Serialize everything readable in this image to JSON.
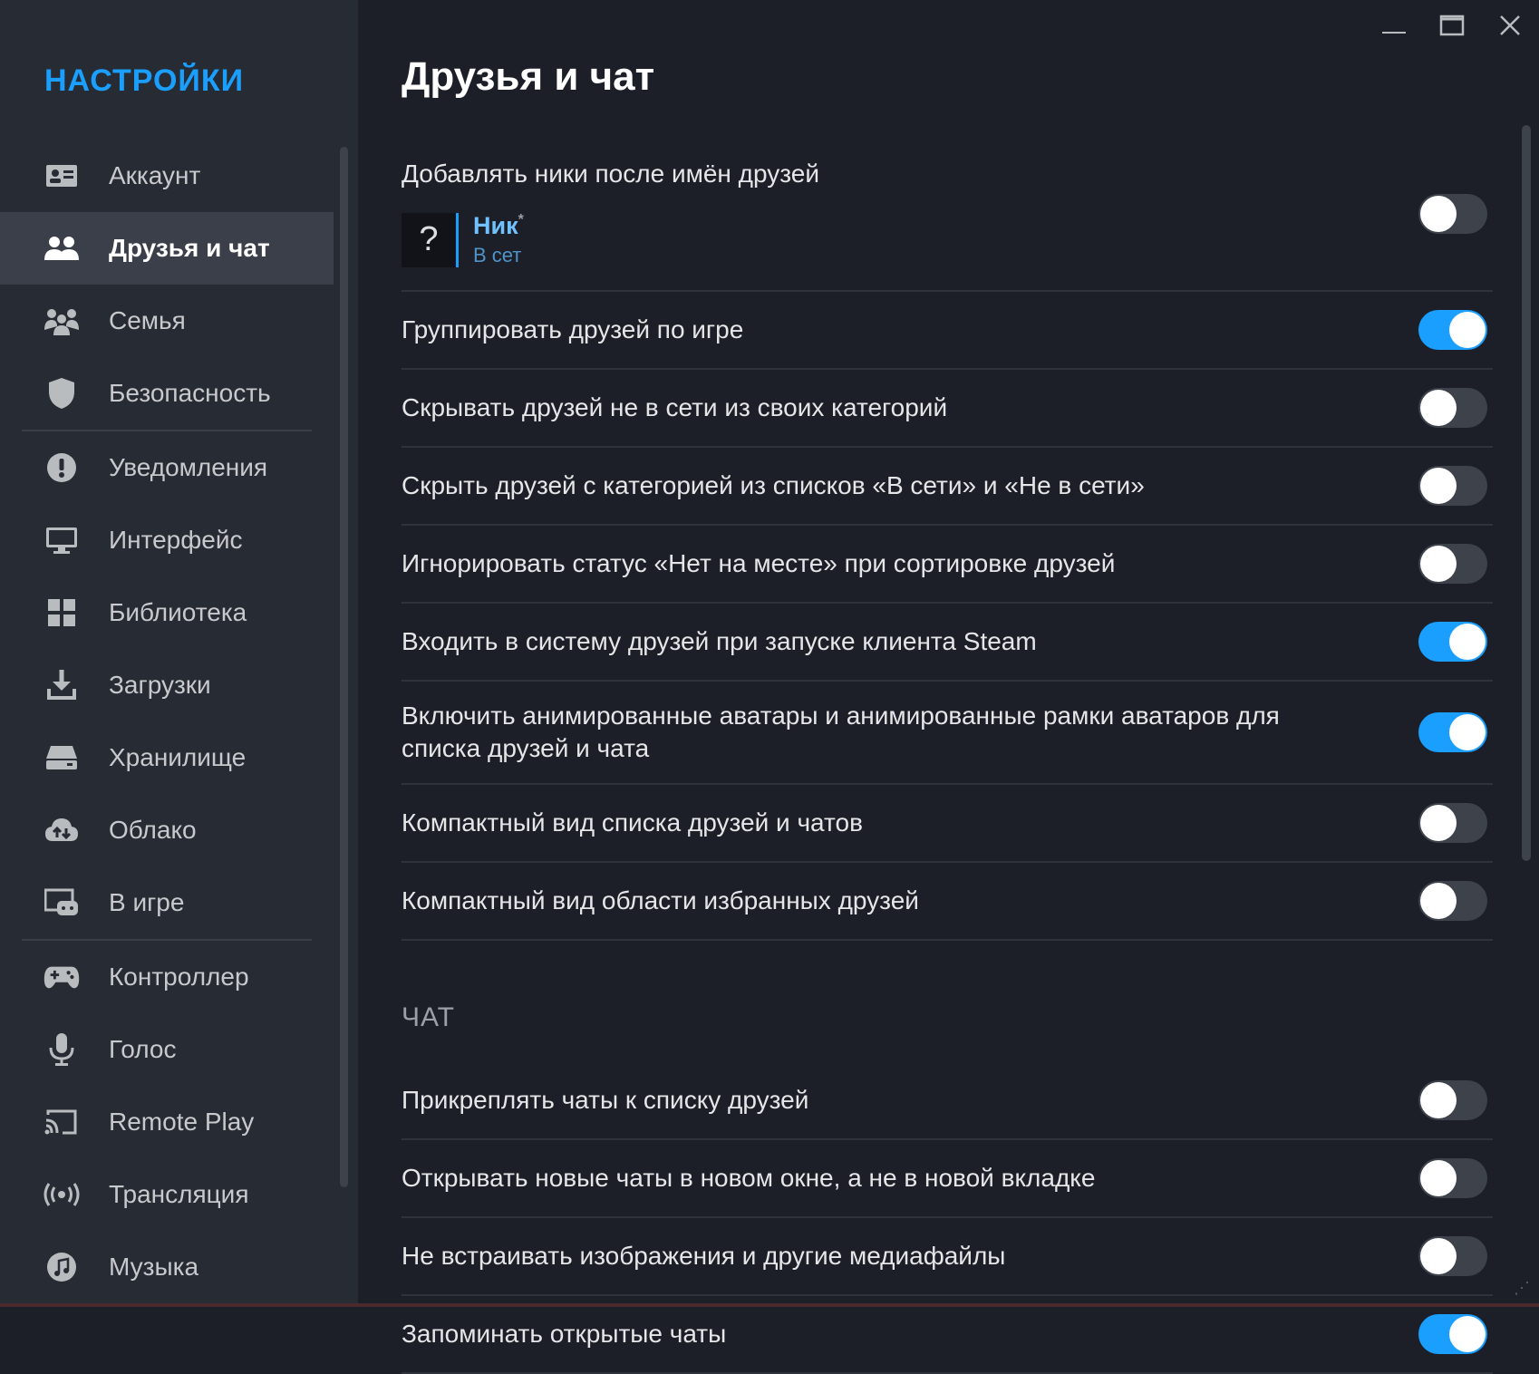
{
  "sidebar": {
    "title": "НАСТРОЙКИ",
    "items": [
      {
        "label": "Аккаунт",
        "icon": "account-card-icon",
        "active": false
      },
      {
        "label": "Друзья и чат",
        "icon": "friends-icon",
        "active": true
      },
      {
        "label": "Семья",
        "icon": "family-icon",
        "active": false
      },
      {
        "label": "Безопасность",
        "icon": "shield-icon",
        "active": false
      },
      {
        "label": "Уведомления",
        "icon": "alert-icon",
        "active": false
      },
      {
        "label": "Интерфейс",
        "icon": "monitor-icon",
        "active": false
      },
      {
        "label": "Библиотека",
        "icon": "grid-icon",
        "active": false
      },
      {
        "label": "Загрузки",
        "icon": "download-icon",
        "active": false
      },
      {
        "label": "Хранилище",
        "icon": "drive-icon",
        "active": false
      },
      {
        "label": "Облако",
        "icon": "cloud-icon",
        "active": false
      },
      {
        "label": "В игре",
        "icon": "in-game-icon",
        "active": false
      },
      {
        "label": "Контроллер",
        "icon": "gamepad-icon",
        "active": false
      },
      {
        "label": "Голос",
        "icon": "microphone-icon",
        "active": false
      },
      {
        "label": "Remote Play",
        "icon": "cast-icon",
        "active": false
      },
      {
        "label": "Трансляция",
        "icon": "broadcast-icon",
        "active": false
      },
      {
        "label": "Музыка",
        "icon": "music-icon",
        "active": false
      }
    ]
  },
  "page": {
    "title": "Друзья и чат"
  },
  "nick_preview": {
    "avatar": "?",
    "name": "Ник",
    "suffix": "*",
    "status": "В сет"
  },
  "settings": [
    {
      "label": "Добавлять ники после имён друзей",
      "on": false
    },
    {
      "label": "Группировать друзей по игре",
      "on": true
    },
    {
      "label": "Скрывать друзей не в сети из своих категорий",
      "on": false
    },
    {
      "label": "Скрыть друзей с категорией из списков «В сети» и «Не в сети»",
      "on": false
    },
    {
      "label": "Игнорировать статус «Нет на месте» при сортировке друзей",
      "on": false
    },
    {
      "label": "Входить в систему друзей при запуске клиента Steam",
      "on": true
    },
    {
      "label": "Включить анимированные аватары и анимированные рамки аватаров для списка друзей и чата",
      "on": true
    },
    {
      "label": "Компактный вид списка друзей и чатов",
      "on": false
    },
    {
      "label": "Компактный вид области избранных друзей",
      "on": false
    }
  ],
  "chat_section": {
    "title": "ЧАТ",
    "settings": [
      {
        "label": "Прикреплять чаты к списку друзей",
        "on": false
      },
      {
        "label": "Открывать новые чаты в новом окне, а не в новой вкладке",
        "on": false
      },
      {
        "label": "Не встраивать изображения и другие медиафайлы",
        "on": false
      },
      {
        "label": "Запоминать открытые чаты",
        "on": true
      }
    ]
  },
  "colors": {
    "accent": "#1a9fff",
    "sidebar_bg": "#272b33",
    "main_bg": "#1c1f27"
  }
}
